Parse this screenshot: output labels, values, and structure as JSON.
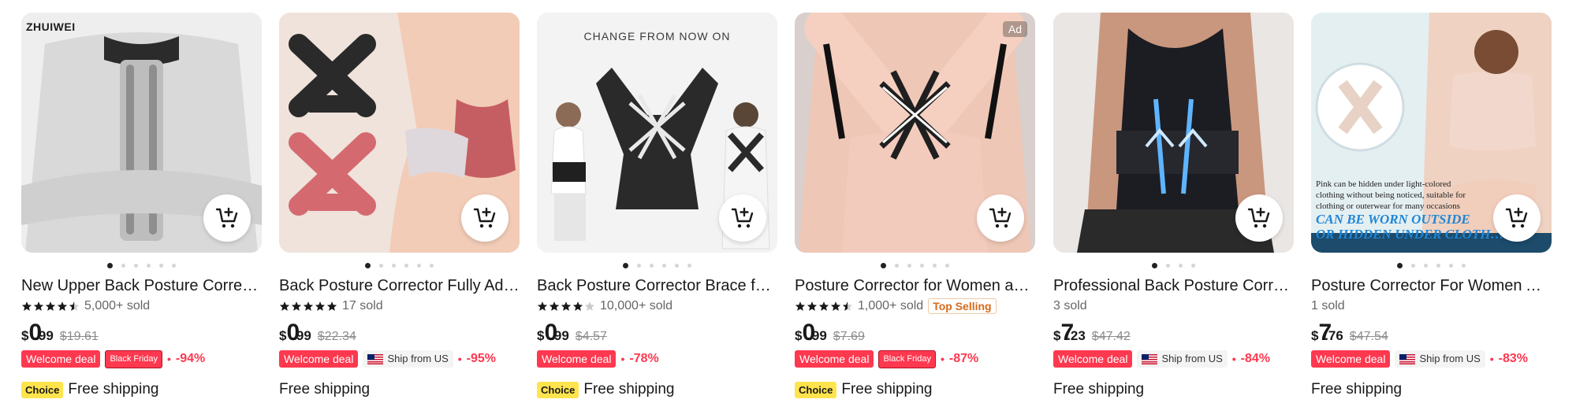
{
  "colors": {
    "accent_red": "#fd384f",
    "choice_yellow": "#ffe44d",
    "top_selling_orange": "#d66a1a",
    "strike_gray": "#8c8c8c"
  },
  "products": [
    {
      "brand": "ZHUIWEI",
      "title": "New Upper Back Posture Correc…",
      "rating": 4.5,
      "sold": "5,000+ sold",
      "price": {
        "currency": "$",
        "int": "0",
        "dec": ".99"
      },
      "original_price": "$19.61",
      "badges": {
        "welcome": "Welcome deal",
        "black_friday": "Black Friday"
      },
      "discount": "-94%",
      "choice": "Choice",
      "shipping": "Free shipping",
      "image_dots": 6,
      "active_dot": 0
    },
    {
      "title": "Back Posture Corrector Fully Adj…",
      "rating": 5,
      "sold": "17 sold",
      "price": {
        "currency": "$",
        "int": "0",
        "dec": ".99"
      },
      "original_price": "$22.34",
      "badges": {
        "welcome": "Welcome deal",
        "ship_from": "Ship from US"
      },
      "discount": "-95%",
      "shipping": "Free shipping",
      "image_dots": 6,
      "active_dot": 0
    },
    {
      "headline": "CHANGE FROM NOW ON",
      "title": "Back Posture Corrector Brace fo…",
      "rating": 4,
      "sold": "10,000+ sold",
      "price": {
        "currency": "$",
        "int": "0",
        "dec": ".99"
      },
      "original_price": "$4.57",
      "badges": {
        "welcome": "Welcome deal"
      },
      "discount": "-78%",
      "choice": "Choice",
      "shipping": "Free shipping",
      "image_dots": 6,
      "active_dot": 0
    },
    {
      "ad": "Ad",
      "title": "Posture Corrector for Women a…",
      "rating": 4.5,
      "sold": "1,000+ sold",
      "top_selling": "Top Selling",
      "price": {
        "currency": "$",
        "int": "0",
        "dec": ".99"
      },
      "original_price": "$7.69",
      "badges": {
        "welcome": "Welcome deal",
        "black_friday": "Black Friday"
      },
      "discount": "-87%",
      "choice": "Choice",
      "shipping": "Free shipping",
      "image_dots": 6,
      "active_dot": 0
    },
    {
      "title": "Professional Back Posture Corre…",
      "sold": "3 sold",
      "price": {
        "currency": "$",
        "int": "7",
        "dec": ".23"
      },
      "original_price": "$47.42",
      "badges": {
        "welcome": "Welcome deal",
        "ship_from": "Ship from US"
      },
      "discount": "-84%",
      "shipping": "Free shipping",
      "image_dots": 4,
      "active_dot": 0
    },
    {
      "overlay_note": "Pink can be hidden under light-colored clothing without being noticed, suitable for clothing or outerwear for many occasions",
      "overlay_big": "CAN BE WORN OUTSIDE\nOR HIDDEN UNDER CLOTH…",
      "title": "Posture Corrector For Women A…",
      "sold": "1 sold",
      "price": {
        "currency": "$",
        "int": "7",
        "dec": ".76"
      },
      "original_price": "$47.54",
      "badges": {
        "welcome": "Welcome deal",
        "ship_from": "Ship from US"
      },
      "discount": "-83%",
      "shipping": "Free shipping",
      "image_dots": 6,
      "active_dot": 0
    }
  ]
}
